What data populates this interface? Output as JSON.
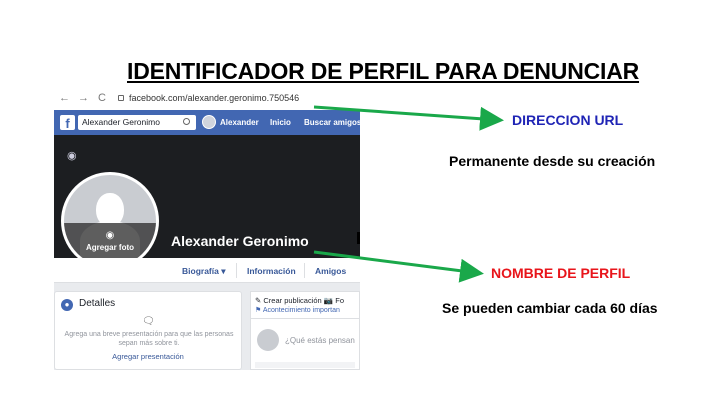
{
  "slide": {
    "title": "IDENTIFICADOR DE PERFIL PARA DENUNCIAR",
    "url_label": "DIRECCION URL",
    "url_description": "Permanente desde su creación",
    "name_label": "NOMBRE DE PERFIL",
    "name_description": "Se pueden cambiar cada 60 días",
    "colors": {
      "arrow": "#1aa84a",
      "url_label": "#1f24b5",
      "name_label": "#e8151b"
    }
  },
  "browser": {
    "back": "←",
    "forward": "→",
    "reload": "C",
    "url": "facebook.com/alexander.geronimo.750546"
  },
  "facebook": {
    "logo": "f",
    "search_value": "Alexander Geronimo",
    "nav_user": "Alexander",
    "nav_home": "Inicio",
    "nav_find_friends": "Buscar amigos",
    "profile_name": "Alexander Geronimo",
    "add_photo": "Agregar foto",
    "tabs": [
      "Biografía ▾",
      "Información",
      "Amigos"
    ],
    "details": {
      "title": "Detalles",
      "description": "Agrega una breve presentación para que las personas sepan más sobre ti.",
      "link": "Agregar presentación"
    },
    "composer": {
      "create_post": "✎ Crear publicación   📷 Fo",
      "life_event": "⚑ Acontecimiento importan",
      "placeholder": "¿Qué estás pensan"
    }
  }
}
